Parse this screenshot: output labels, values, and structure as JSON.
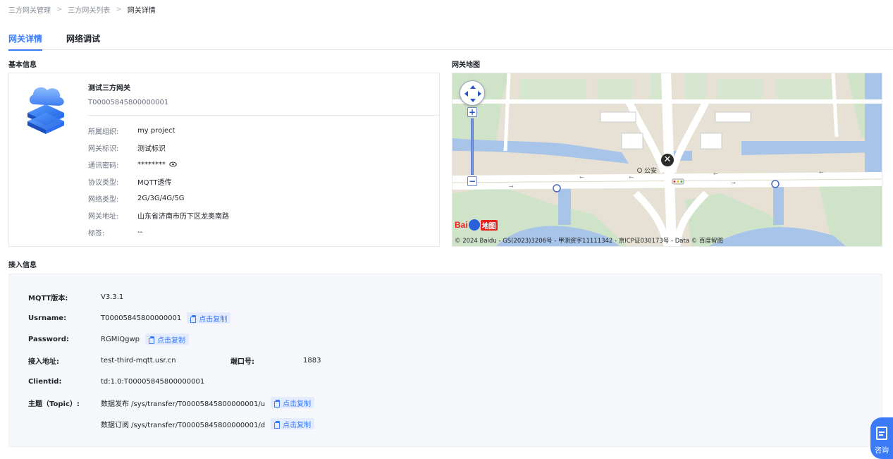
{
  "breadcrumb": [
    "三方网关管理",
    "三方网关列表",
    "网关详情"
  ],
  "tabs": [
    "网关详情",
    "网络调试"
  ],
  "sections": {
    "basic": "基本信息",
    "map": "网关地图",
    "access": "接入信息"
  },
  "gateway": {
    "name": "测试三方网关",
    "sn": "T00005845800000001",
    "fields": [
      {
        "label": "所属组织:",
        "value": "my project"
      },
      {
        "label": "网关标识:",
        "value": "测试标识"
      },
      {
        "label": "通讯密码:",
        "value": "********"
      },
      {
        "label": "协议类型:",
        "value": "MQTT透传"
      },
      {
        "label": "网络类型:",
        "value": "2G/3G/4G/5G"
      },
      {
        "label": "网关地址:",
        "value": "山东省济南市历下区龙奥南路"
      },
      {
        "label": "标签:",
        "value": "--"
      }
    ]
  },
  "map": {
    "copyright": "© 2024 Baidu - GS(2023)3206号 - 甲测资字11111342 - 京ICP证030173号 - Data © 百度智图",
    "logo_bai": "Bai",
    "logo_du": "地图",
    "poi": "公安"
  },
  "access": {
    "mqtt_label": "MQTT版本:",
    "mqtt_value": "V3.3.1",
    "username_label": "Usrname:",
    "username_value": "T00005845800000001",
    "password_label": "Password:",
    "password_value": "RGMIQgwp",
    "address_label": "接入地址:",
    "address_value": "test-third-mqtt.usr.cn",
    "port_label": "端口号:",
    "port_value": "1883",
    "clientid_label": "Clientid:",
    "clientid_value": "td:1.0:T00005845800000001",
    "topic_label": "主题（Topic）:",
    "topic_pub": "数据发布 /sys/transfer/T00005845800000001/u",
    "topic_sub": "数据订阅 /sys/transfer/T00005845800000001/d",
    "copy_label": "点击复制"
  },
  "consult_label": "咨询",
  "colors": {
    "primary": "#3a7af7",
    "copy_bg": "#e3ecfe",
    "panel_bg": "#f5f7fa"
  }
}
